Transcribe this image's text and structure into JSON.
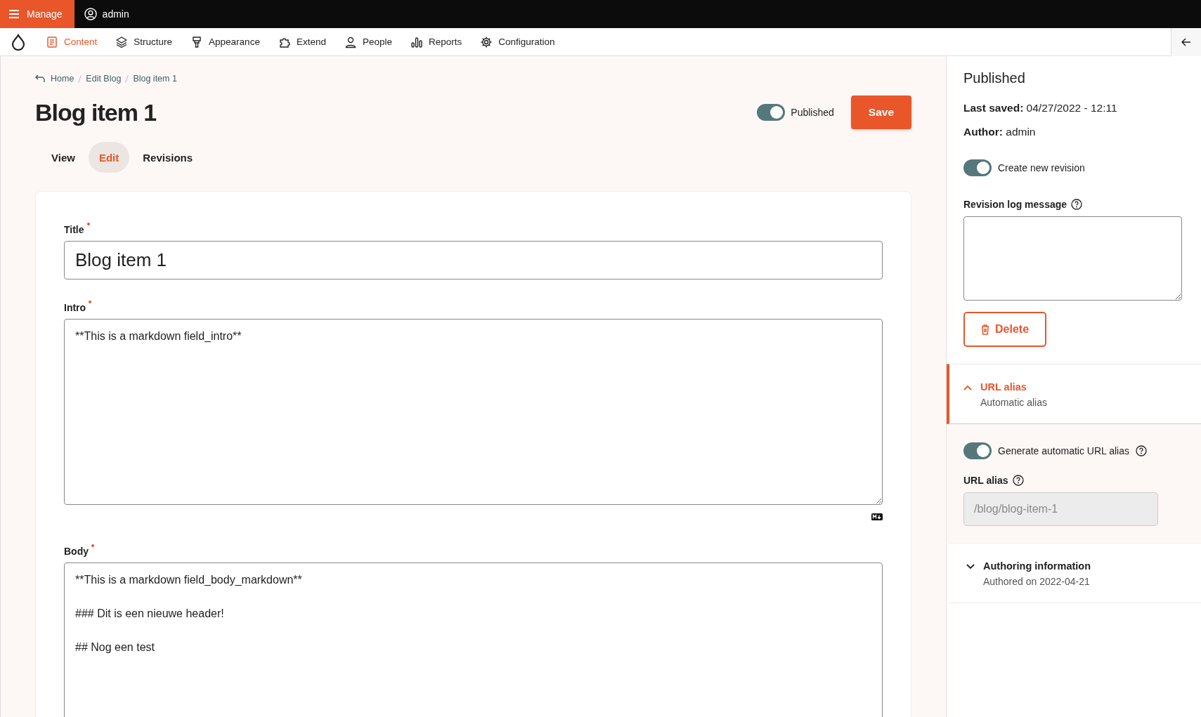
{
  "top_bar": {
    "manage": "Manage",
    "user": "admin"
  },
  "nav": [
    {
      "label": "Content",
      "selected": true
    },
    {
      "label": "Structure",
      "selected": false
    },
    {
      "label": "Appearance",
      "selected": false
    },
    {
      "label": "Extend",
      "selected": false
    },
    {
      "label": "People",
      "selected": false
    },
    {
      "label": "Reports",
      "selected": false
    },
    {
      "label": "Configuration",
      "selected": false
    }
  ],
  "breadcrumb": [
    "Home",
    "Edit Blog",
    "Blog item 1"
  ],
  "page_title": "Blog item 1",
  "published_toggle": {
    "label": "Published",
    "on": true
  },
  "save_button": "Save",
  "tabs": [
    {
      "label": "View",
      "selected": false
    },
    {
      "label": "Edit",
      "selected": true
    },
    {
      "label": "Revisions",
      "selected": false
    }
  ],
  "fields": [
    {
      "label": "Title",
      "required": true,
      "kind": "input",
      "value": "Blog item 1"
    },
    {
      "label": "Intro",
      "required": true,
      "kind": "textarea",
      "value": "**This is a markdown field_intro**"
    },
    {
      "label": "Body",
      "required": true,
      "kind": "textarea",
      "value": "**This is a markdown field_body_markdown**\n\n### Dit is een nieuwe header!\n\n## Nog een test"
    }
  ],
  "sidebar": {
    "heading": "Published",
    "last_saved": {
      "label": "Last saved:",
      "value": "04/27/2022 - 12:11"
    },
    "author": {
      "label": "Author:",
      "value": "admin"
    },
    "new_revision": {
      "label": "Create new revision",
      "on": true
    },
    "revision_log_label": "Revision log message",
    "delete_button": "Delete",
    "sections": [
      {
        "title": "URL alias",
        "summary": "Automatic alias",
        "expanded": true
      },
      {
        "title": "Authoring information",
        "summary": "Authored on 2022-04-21",
        "expanded": false
      }
    ],
    "url_alias": {
      "toggle_label": "Generate automatic URL alias",
      "on": true,
      "field_label": "URL alias",
      "placeholder": "/blog/blog-item-1"
    }
  }
}
